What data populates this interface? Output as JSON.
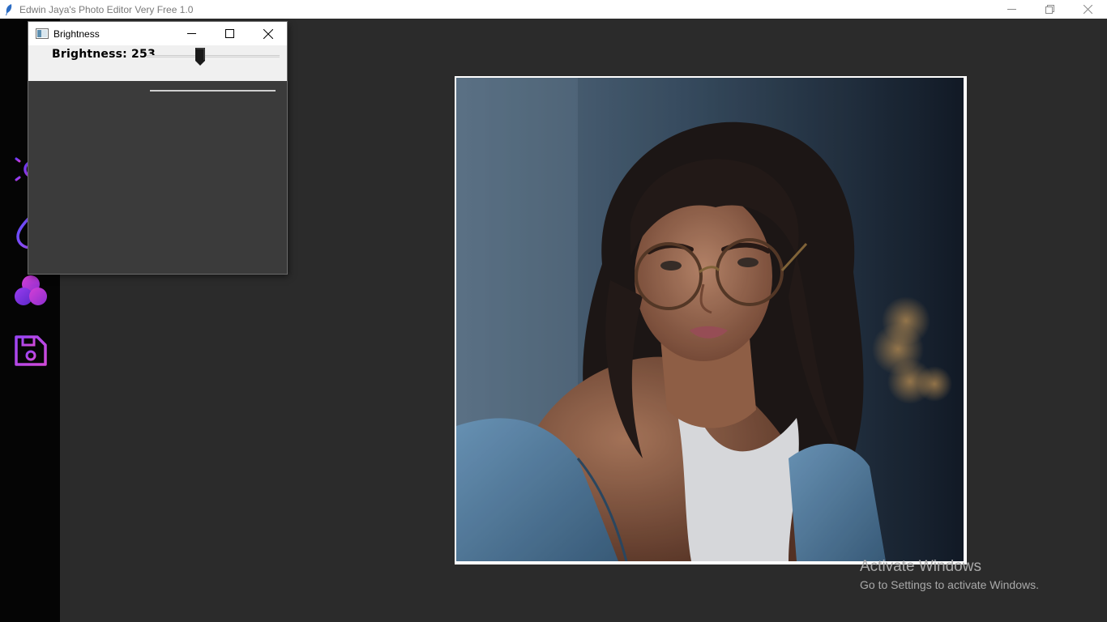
{
  "window": {
    "title": "Edwin Jaya's Photo Editor Very Free 1.0"
  },
  "sidebar": {
    "tools": [
      {
        "icon": "sun-icon"
      },
      {
        "icon": "drop-icon"
      },
      {
        "icon": "color-circles-icon"
      },
      {
        "icon": "save-icon"
      }
    ],
    "accent_colors": [
      "#7a3cff",
      "#c83cd9"
    ]
  },
  "dialog": {
    "title": "Brightness",
    "label_prefix": "Brightness: ",
    "brightness_value": 253,
    "brightness_label": "Brightness: 253",
    "slider_fraction": 0.4
  },
  "watermark": {
    "title": "Activate Windows",
    "subtitle": "Go to Settings to activate Windows."
  },
  "colors": {
    "canvas_bg": "#2b2b2b",
    "sidebar_bg": "#050505",
    "dialog_bg": "#3b3b3b"
  }
}
